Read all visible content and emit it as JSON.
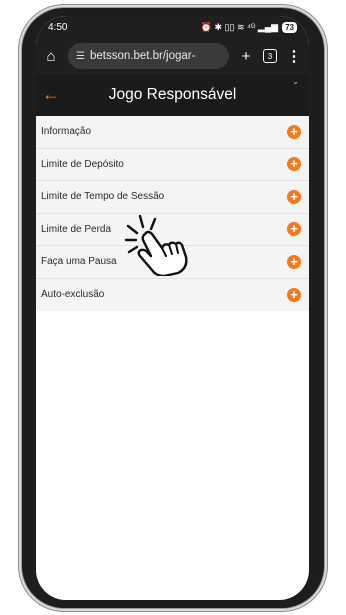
{
  "status_bar": {
    "time": "4:50",
    "icons_text": "⏰ ✱ ▯▯ ≋ ⁴ᴳ ▂▄▆",
    "battery": "73"
  },
  "browser": {
    "url": "betsson.bet.br/jogar-",
    "tab_count": "3",
    "icons": [
      "home-icon",
      "site-settings-icon",
      "new-tab-icon",
      "tabs-icon",
      "menu-icon"
    ]
  },
  "header": {
    "title": "Jogo Responsável"
  },
  "menu": {
    "items": [
      {
        "label": "Informação"
      },
      {
        "label": "Limite de Depósito"
      },
      {
        "label": "Limite de Tempo de Sessão"
      },
      {
        "label": "Limite de Perda"
      },
      {
        "label": "Faça uma Pausa"
      },
      {
        "label": "Auto-exclusão"
      }
    ]
  },
  "colors": {
    "accent": "#f47a20",
    "header_bg": "#1a1a1a",
    "list_bg": "#f4f4f4"
  }
}
